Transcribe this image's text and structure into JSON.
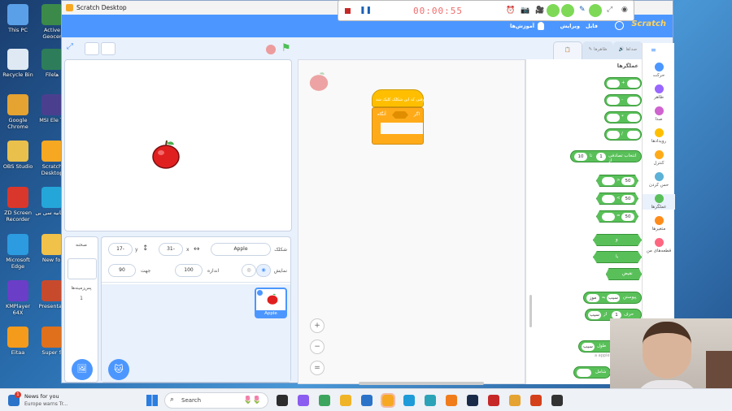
{
  "desktop_icons": [
    {
      "label": "This PC",
      "color": "#5aa0e8"
    },
    {
      "label": "Recycle Bin",
      "color": "#dfe9f3"
    },
    {
      "label": "Google Chrome",
      "color": "#e5a331"
    },
    {
      "label": "OBS Studio",
      "color": "#e9c04b"
    },
    {
      "label": "ZD Screen Recorder",
      "color": "#d9372b"
    },
    {
      "label": "Microsoft Edge",
      "color": "#2c9be0"
    },
    {
      "label": "KMPlayer 64X",
      "color": "#6b3ec7"
    },
    {
      "label": "Eitaa",
      "color": "#f59b1c"
    },
    {
      "label": "Active Geocer",
      "color": "#3b8a4a"
    },
    {
      "label": "Fileها",
      "color": "#2d7d5a"
    },
    {
      "label": "MSI Ele TI",
      "color": "#4a3f8f"
    },
    {
      "label": "Scratch Desktop",
      "color": "#f7a823"
    },
    {
      "label": "شلتانیه سی بی",
      "color": "#25a6d9"
    },
    {
      "label": "New fol",
      "color": "#f0c24a"
    },
    {
      "label": "Presentati",
      "color": "#c84a2d"
    },
    {
      "label": "Super S",
      "color": "#e0701c"
    }
  ],
  "window": {
    "title": "Scratch Desktop"
  },
  "menubar": {
    "logo": "Scratch",
    "file": "فایل",
    "edit": "ویرایش",
    "tutorials": "آموزش‌ها"
  },
  "tabs": {
    "code": "کدها",
    "costumes": "ظاهرها",
    "sounds": "صداها"
  },
  "sprite": {
    "name_label": "شکلک",
    "name": "Apple",
    "x_label": "x",
    "x": "31-",
    "y_label": "y",
    "y": "17-",
    "show_label": "نمایش",
    "size_label": "اندازه",
    "size": "100",
    "direction_label": "جهت",
    "direction": "90",
    "thumb_label": "Apple"
  },
  "stage_panel": {
    "title": "صحنه",
    "backdrops_label": "پس‌زمینه‌ها",
    "backdrops_count": "1"
  },
  "code_blocks": {
    "hat": "وقتی که این شکلک کلیک شد",
    "if": "اگر",
    "then": "آنگاه"
  },
  "palette": {
    "heading": "عملگرها",
    "ops": [
      "+",
      "-",
      "*",
      "/"
    ],
    "random": "انتخاب تصادفی از",
    "random_from": "1",
    "random_to": "10",
    "random_to_label": "تا",
    "gt": ">",
    "lt": "<",
    "eq": "=",
    "cmp_val": "50",
    "and": "و",
    "or": "یا",
    "not": "نقیض",
    "join": "پیوستن",
    "join_a": "سیب",
    "join_b": "موز",
    "join_to": "به",
    "letter": "حرف",
    "letter_n": "1",
    "letter_of": "از",
    "letter_word": "سیب",
    "length": "طول",
    "length_word": "سیب",
    "contains": "شامل",
    "apple_label": "a apple"
  },
  "categories": [
    {
      "label": "حرکت",
      "color": "#4c97ff"
    },
    {
      "label": "ظاهر",
      "color": "#9966ff"
    },
    {
      "label": "صدا",
      "color": "#cf63cf"
    },
    {
      "label": "رویدادها",
      "color": "#ffbf00"
    },
    {
      "label": "کنترل",
      "color": "#ffab19"
    },
    {
      "label": "حس کردن",
      "color": "#5cb1d6"
    },
    {
      "label": "عملگرها",
      "color": "#59c059"
    },
    {
      "label": "متغیرها",
      "color": "#ff8c1a"
    },
    {
      "label": "قطعه‌های من",
      "color": "#ff6680"
    }
  ],
  "recorder": {
    "time": "00:00:55"
  },
  "taskbar": {
    "news_title": "News for you",
    "news_sub": "Europe warns Tr...",
    "news_badge": "1",
    "search_placeholder": "Search"
  }
}
